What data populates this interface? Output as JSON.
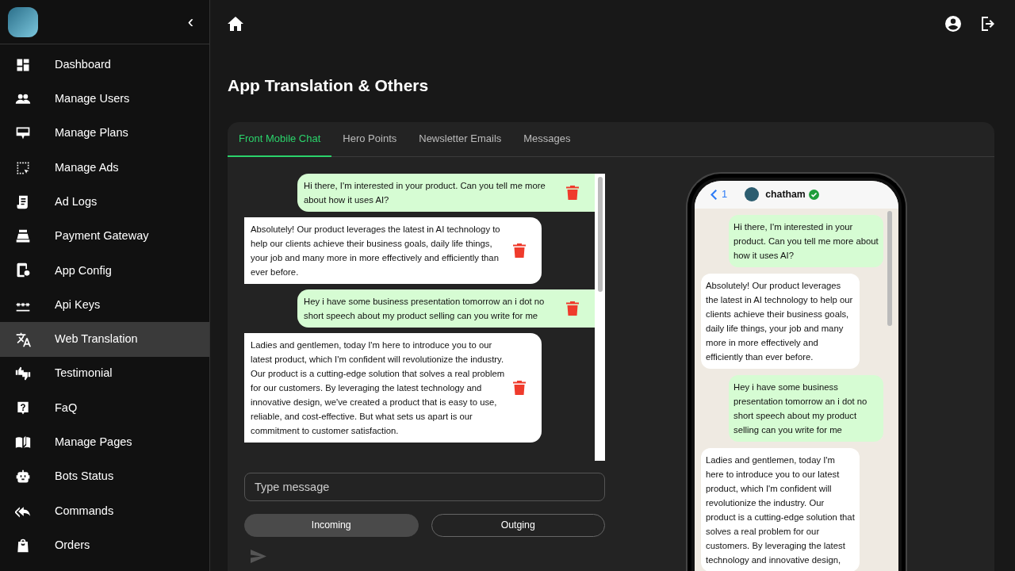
{
  "sidebar": {
    "collapse_label": "‹",
    "items": [
      {
        "label": "Dashboard",
        "kind": "dashboard",
        "selected": false
      },
      {
        "label": "Manage Users",
        "kind": "users",
        "selected": false
      },
      {
        "label": "Manage Plans",
        "kind": "plans",
        "selected": false
      },
      {
        "label": "Manage Ads",
        "kind": "ads",
        "selected": false
      },
      {
        "label": "Ad Logs",
        "kind": "logs",
        "selected": false
      },
      {
        "label": "Payment Gateway",
        "kind": "register",
        "selected": false
      },
      {
        "label": "App Config",
        "kind": "config",
        "selected": false
      },
      {
        "label": "Api Keys",
        "kind": "keys",
        "selected": false
      },
      {
        "label": "Web Translation",
        "kind": "translate",
        "selected": true
      },
      {
        "label": "Testimonial",
        "kind": "thumbs",
        "selected": false
      },
      {
        "label": "FaQ",
        "kind": "faq",
        "selected": false
      },
      {
        "label": "Manage Pages",
        "kind": "book",
        "selected": false
      },
      {
        "label": "Bots Status",
        "kind": "robot",
        "selected": false
      },
      {
        "label": "Commands",
        "kind": "replyall",
        "selected": false
      },
      {
        "label": "Orders",
        "kind": "bag",
        "selected": false
      }
    ]
  },
  "page_title": "App Translation & Others",
  "tabs": [
    {
      "label": "Front Mobile Chat",
      "selected": true
    },
    {
      "label": "Hero Points",
      "selected": false
    },
    {
      "label": "Newsletter Emails",
      "selected": false
    },
    {
      "label": "Messages",
      "selected": false
    }
  ],
  "chat_editor": {
    "messages": [
      {
        "kind": "outgoing",
        "text": "Hi there, I'm interested in your product. Can you tell me more about how it uses AI?"
      },
      {
        "kind": "incoming",
        "text": "Absolutely! Our product leverages the latest in AI technology to help our clients achieve their business goals, daily life things, your job and many more in more effectively and efficiently than ever before."
      },
      {
        "kind": "outgoing",
        "text": "Hey i have some business presentation tomorrow an i dot no short speech about my product selling can you write for me"
      },
      {
        "kind": "incoming",
        "text": "Ladies and gentlemen, today I'm here to introduce you to our latest product, which I'm confident will revolutionize the industry. Our product is a cutting-edge solution that solves a real problem for our customers. By leveraging the latest technology and innovative design, we've created a product that is easy to use, reliable, and cost-effective. But what sets us apart is our commitment to customer satisfaction."
      }
    ],
    "input": {
      "placeholder": "Type message"
    },
    "direction_buttons": [
      {
        "label": "Incoming",
        "selected": true
      },
      {
        "label": "Outging",
        "selected": false
      }
    ]
  },
  "phone_preview": {
    "back_count": "1",
    "contact_name": "chatham",
    "verified": true,
    "messages": [
      {
        "kind": "outgoing",
        "text": "Hi there, I'm interested in your product. Can you tell me more about how it uses AI?"
      },
      {
        "kind": "incoming",
        "text": "Absolutely! Our product leverages the latest in AI technology to help our clients achieve their business goals, daily life things, your job and many more in more effectively and efficiently than ever before."
      },
      {
        "kind": "outgoing",
        "text": "Hey i have some business presentation tomorrow an i dot no short speech about my product selling can you write for me"
      },
      {
        "kind": "incoming",
        "text": "Ladies and gentlemen, today I'm here to introduce you to our latest product, which I'm confident will revolutionize the industry. Our product is a cutting-edge solution that solves a real problem for our customers. By leveraging the latest technology and innovative design,"
      }
    ]
  }
}
